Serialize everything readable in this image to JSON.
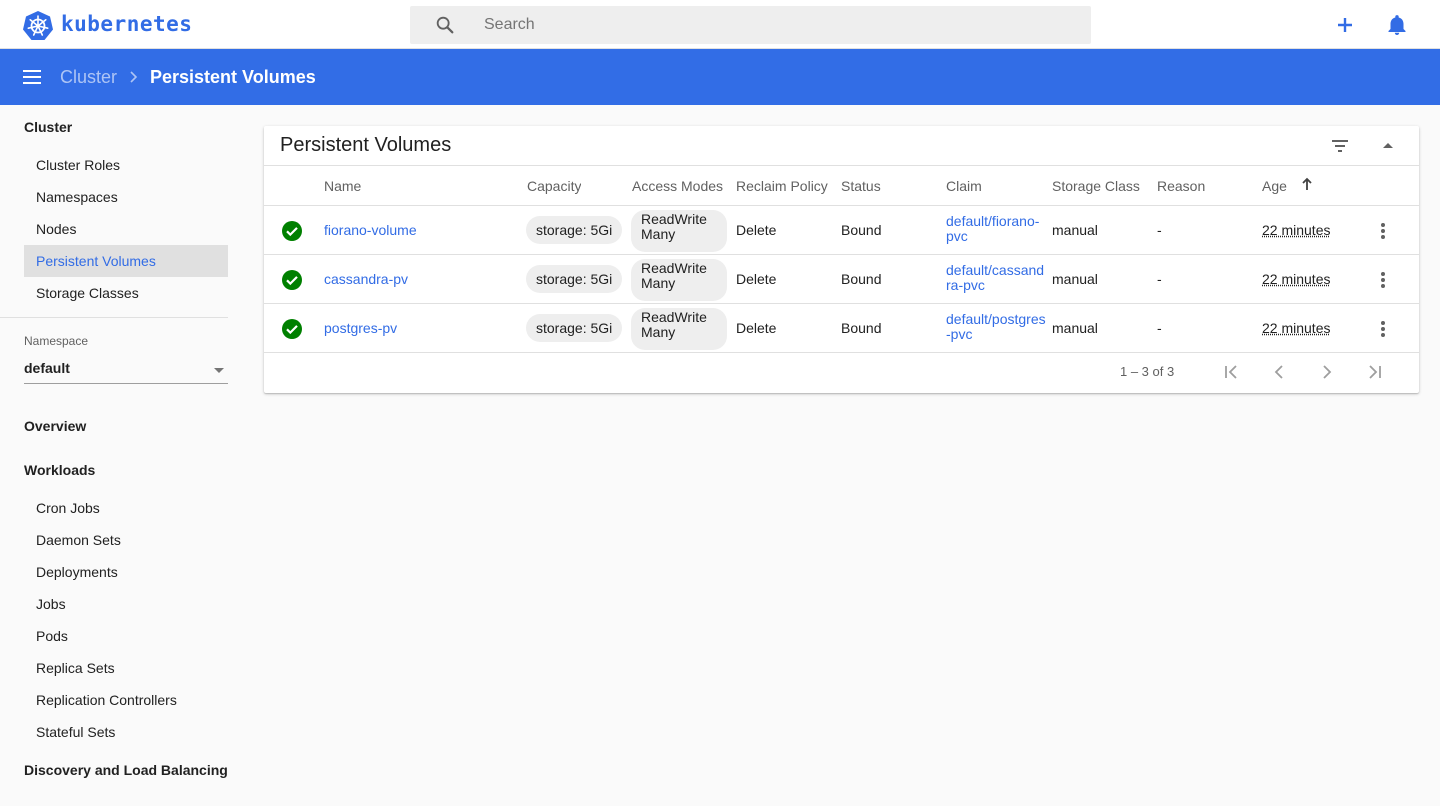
{
  "brand": "kubernetes",
  "search": {
    "placeholder": "Search"
  },
  "breadcrumb": {
    "parent": "Cluster",
    "current": "Persistent Volumes"
  },
  "sidebar": {
    "cluster_title": "Cluster",
    "cluster_items": [
      "Cluster Roles",
      "Namespaces",
      "Nodes",
      "Persistent Volumes",
      "Storage Classes"
    ],
    "active_item": "Persistent Volumes",
    "namespace_label": "Namespace",
    "namespace_value": "default",
    "overview": "Overview",
    "workloads_title": "Workloads",
    "workload_items": [
      "Cron Jobs",
      "Daemon Sets",
      "Deployments",
      "Jobs",
      "Pods",
      "Replica Sets",
      "Replication Controllers",
      "Stateful Sets"
    ],
    "discovery_title": "Discovery and Load Balancing"
  },
  "card": {
    "title": "Persistent Volumes",
    "columns": [
      "Name",
      "Capacity",
      "Access Modes",
      "Reclaim Policy",
      "Status",
      "Claim",
      "Storage Class",
      "Reason",
      "Age"
    ],
    "rows": [
      {
        "name": "fiorano-volume",
        "capacity": "storage: 5Gi",
        "access": "ReadWriteMany",
        "reclaim": "Delete",
        "status": "Bound",
        "claim": "default/fiorano-pvc",
        "storage_class": "manual",
        "reason": "-",
        "age": "22 minutes"
      },
      {
        "name": "cassandra-pv",
        "capacity": "storage: 5Gi",
        "access": "ReadWriteMany",
        "reclaim": "Delete",
        "status": "Bound",
        "claim": "default/cassandra-pvc",
        "storage_class": "manual",
        "reason": "-",
        "age": "22 minutes"
      },
      {
        "name": "postgres-pv",
        "capacity": "storage: 5Gi",
        "access": "ReadWriteMany",
        "reclaim": "Delete",
        "status": "Bound",
        "claim": "default/postgres-pvc",
        "storage_class": "manual",
        "reason": "-",
        "age": "22 minutes"
      }
    ],
    "pagination": "1 – 3 of 3"
  },
  "colors": {
    "brand": "#326ce5",
    "header": "#326de6",
    "success": "#008000"
  },
  "icons": {
    "search": "search-icon",
    "add": "plus-icon",
    "notifications": "bell-icon",
    "menu": "menu-icon",
    "filter": "filter-icon",
    "collapse": "arrow-drop-up-icon",
    "status": "check-circle-icon",
    "row_menu": "more-vert-icon",
    "sort": "arrow-upward-icon"
  }
}
